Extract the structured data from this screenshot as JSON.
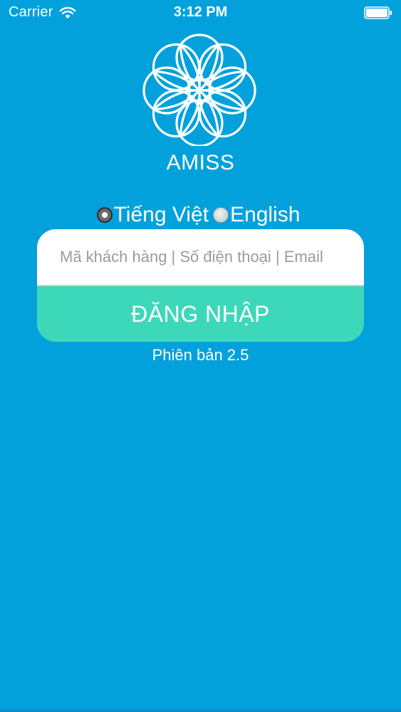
{
  "status_bar": {
    "carrier": "Carrier",
    "time": "3:12 PM",
    "wifi_icon": "wifi-icon",
    "battery_icon": "battery-icon"
  },
  "brand": {
    "name": "AMISS",
    "logo_icon": "flower-logo-icon"
  },
  "language": {
    "options": [
      {
        "label": "Tiếng Việt",
        "selected": true
      },
      {
        "label": "English",
        "selected": false
      }
    ]
  },
  "login": {
    "input_value": "",
    "input_placeholder": "Mã khách hàng | Số điện thoại | Email",
    "button_label": "ĐĂNG NHẬP"
  },
  "version": "Phiên bản 2.5",
  "colors": {
    "background": "#03a1dc",
    "button": "#3dd8b9",
    "input_bg": "#ffffff"
  }
}
